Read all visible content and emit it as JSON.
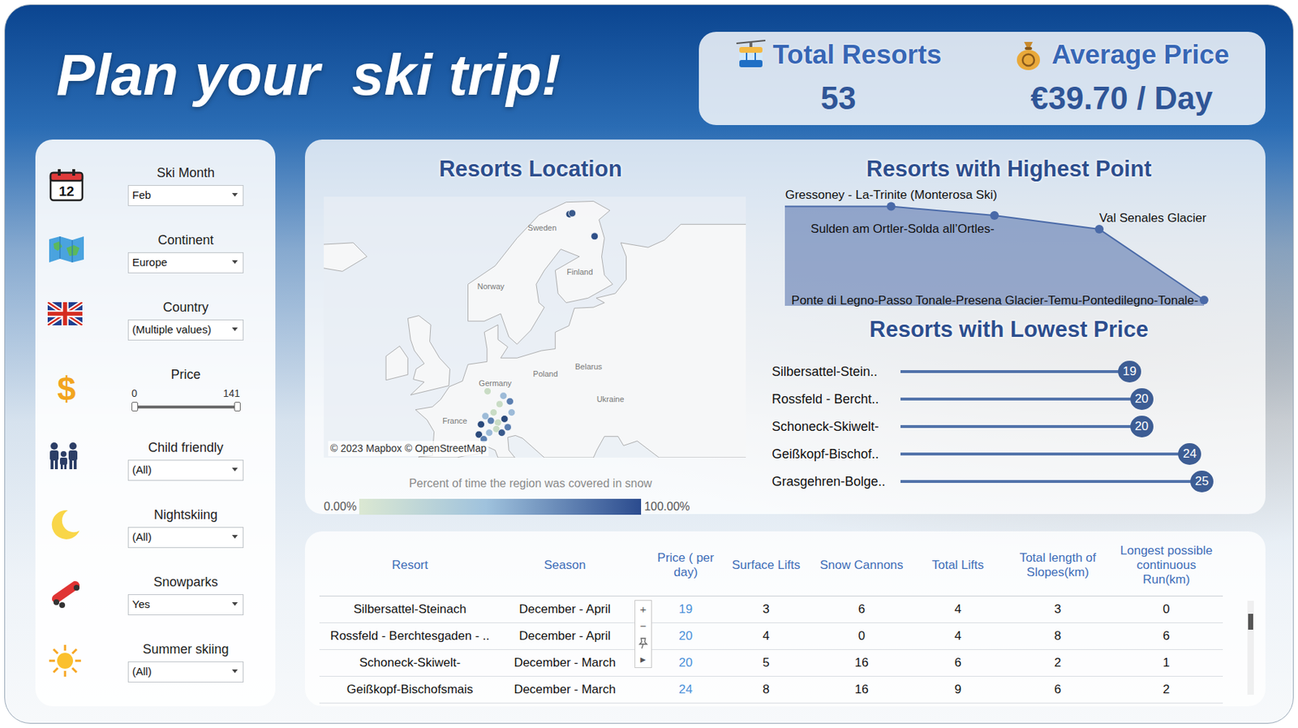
{
  "title": "Plan your  ski trip!",
  "kpis": [
    {
      "label": "Total Resorts",
      "value": "53"
    },
    {
      "label": "Average Price",
      "value": "€39.70 / Day"
    }
  ],
  "filters": [
    {
      "label": "Ski Month",
      "kind": "dropdown",
      "value": "Feb",
      "icon_text": "12"
    },
    {
      "label": "Continent",
      "kind": "dropdown",
      "value": "Europe"
    },
    {
      "label": "Country",
      "kind": "dropdown",
      "value": "(Multiple values)"
    },
    {
      "label": "Price",
      "kind": "range",
      "min": "0",
      "max": "141",
      "level_low": 0,
      "level_high": 1,
      "icon_text": "$"
    },
    {
      "label": "Child friendly",
      "kind": "dropdown",
      "value": "(All)"
    },
    {
      "label": "Nightskiing",
      "kind": "dropdown",
      "value": "(All)"
    },
    {
      "label": "Snowparks",
      "kind": "dropdown",
      "value": "Yes"
    },
    {
      "label": "Summer skiing",
      "kind": "dropdown",
      "value": "(All)"
    }
  ],
  "map": {
    "title": "Resorts Location",
    "attribution": "© 2023 Mapbox © OpenStreetMap",
    "labels": [
      {
        "text": "Sweden",
        "lon": 18.6,
        "lat": 67.8
      },
      {
        "text": "Finland",
        "lon": 25.5,
        "lat": 63.0
      },
      {
        "text": "Norway",
        "lon": 9.2,
        "lat": 61.5
      },
      {
        "text": "Poland",
        "lon": 19.2,
        "lat": 52.0
      },
      {
        "text": "Belarus",
        "lon": 27.1,
        "lat": 52.8
      },
      {
        "text": "Germany",
        "lon": 10.0,
        "lat": 51.0
      },
      {
        "text": "France",
        "lon": 2.6,
        "lat": 46.9
      },
      {
        "text": "Ukraine",
        "lon": 31.1,
        "lat": 49.2
      }
    ],
    "pins": [
      {
        "lon": 23.6,
        "lat": 69.6,
        "color": "#2b4a7c"
      },
      {
        "lon": 24.1,
        "lat": 69.7,
        "color": "#3a5a8c"
      },
      {
        "lon": 28.2,
        "lat": 67.2,
        "color": "#2f5088"
      },
      {
        "lon": 8.6,
        "lat": 50.4,
        "color": "#c9dcc5"
      },
      {
        "lon": 11.5,
        "lat": 49.9,
        "color": "#9dbbd8"
      },
      {
        "lon": 10.8,
        "lat": 49.0,
        "color": "#c9dcc5"
      },
      {
        "lon": 12.7,
        "lat": 49.3,
        "color": "#5b7fb0"
      },
      {
        "lon": 7.4,
        "lat": 46.8,
        "color": "#2b4a7c"
      },
      {
        "lon": 8.2,
        "lat": 47.7,
        "color": "#9dbbd8"
      },
      {
        "lon": 9.2,
        "lat": 47.2,
        "color": "#5b7fb0"
      },
      {
        "lon": 10.5,
        "lat": 47.0,
        "color": "#c9dcc5"
      },
      {
        "lon": 11.7,
        "lat": 47.4,
        "color": "#2b4a7c"
      },
      {
        "lon": 12.3,
        "lat": 46.5,
        "color": "#5b7fb0"
      },
      {
        "lon": 10.2,
        "lat": 46.3,
        "color": "#c9dcc5"
      },
      {
        "lon": 11.2,
        "lat": 45.9,
        "color": "#3a5a8c"
      },
      {
        "lon": 8.9,
        "lat": 45.9,
        "color": "#9dbbd8"
      },
      {
        "lon": 7.0,
        "lat": 45.7,
        "color": "#2b4a7c"
      },
      {
        "lon": 7.9,
        "lat": 45.2,
        "color": "#5b7fb0"
      },
      {
        "lon": 13.0,
        "lat": 48.1,
        "color": "#9dbbd8"
      },
      {
        "lon": 9.7,
        "lat": 48.1,
        "color": "#c9dcc5"
      }
    ],
    "legend": {
      "title": "Percent of time the region was covered in snow",
      "min": "0.00%",
      "max": "100.00%"
    }
  },
  "highest": {
    "title": "Resorts with Highest Point",
    "points": [
      {
        "label": "Gressoney - La-Trinite (Monterosa Ski)",
        "value": 3275
      },
      {
        "label": "Sulden am Ortler-Solda all’Ortles-",
        "value": 3250
      },
      {
        "label": "Val Senales Glacier",
        "value": 3212
      },
      {
        "label": "Ponte di Legno-Passo Tonale-Presena Glacier-Temu-Pontedilegno-Tonale-",
        "value": 3016
      }
    ]
  },
  "lowest": {
    "title": "Resorts with Lowest Price",
    "rows": [
      {
        "label": "Silbersattel-Stein..",
        "value": 19,
        "reading": "19"
      },
      {
        "label": "Rossfeld - Bercht..",
        "value": 20,
        "reading": "20"
      },
      {
        "label": "Schoneck-Skiwelt-",
        "value": 20,
        "reading": "20"
      },
      {
        "label": "Geißkopf-Bischof..",
        "value": 24,
        "reading": "24"
      },
      {
        "label": "Grasgehren-Bolge..",
        "value": 25,
        "reading": "25"
      }
    ]
  },
  "table": {
    "columns": [
      "Resort",
      "Season",
      "Price ( per day)",
      "Surface Lifts",
      "Snow Cannons",
      "Total Lifts",
      "Total length of Slopes(km)",
      "Longest possible continuous Run(km)"
    ],
    "rows": [
      [
        "Silbersattel-Steinach",
        "December - April",
        "19",
        "3",
        "6",
        "4",
        "3",
        "0"
      ],
      [
        "Rossfeld - Berchtesgaden - ..",
        "December - April",
        "20",
        "4",
        "0",
        "4",
        "8",
        "6"
      ],
      [
        "Schoneck-Skiwelt-",
        "December - March",
        "20",
        "5",
        "16",
        "6",
        "2",
        "1"
      ],
      [
        "Geißkopf-Bischofsmais",
        "December - March",
        "24",
        "8",
        "16",
        "9",
        "6",
        "2"
      ]
    ],
    "scrollbar": {
      "level": 0.17
    }
  },
  "map_tools": [
    {
      "kind": "text",
      "label": "+"
    },
    {
      "kind": "text",
      "label": "−"
    },
    {
      "kind": "pin"
    },
    {
      "kind": "text",
      "label": "▸"
    }
  ]
}
